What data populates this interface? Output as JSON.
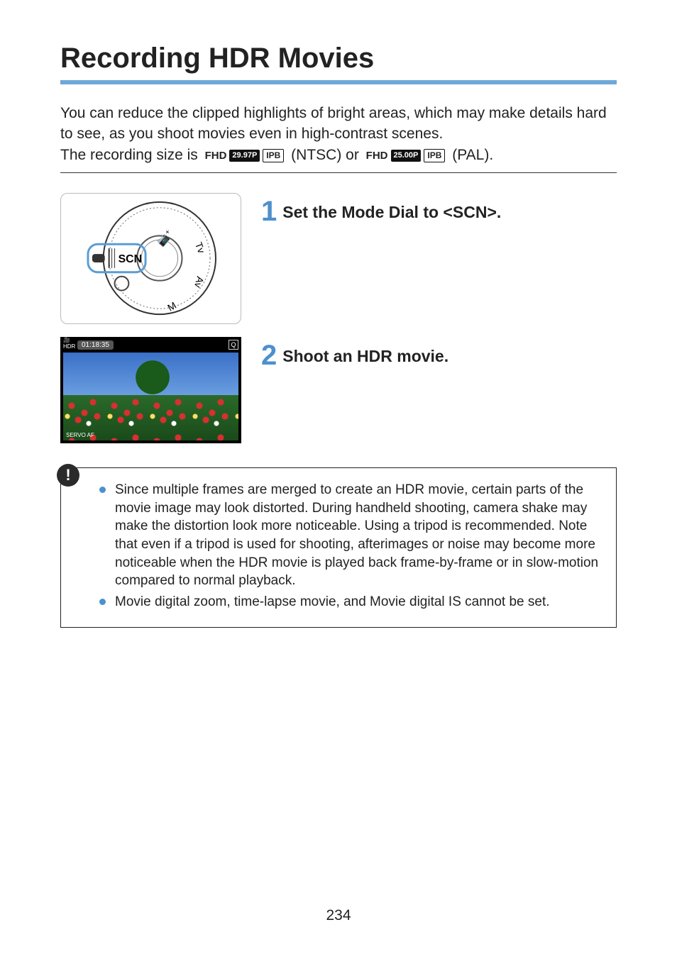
{
  "title": "Recording HDR Movies",
  "intro": {
    "line1": "You can reduce the clipped highlights of bright areas, which may make details hard to see, as you shoot movies even in high-contrast scenes.",
    "rec_label": "The recording size is",
    "ntsc": "(NTSC) or",
    "pal": "(PAL).",
    "fhd": "FHD",
    "fps_ntsc": "29.97P",
    "fps_pal": "25.00P",
    "ipb": "IPB"
  },
  "steps": [
    {
      "number": "1",
      "title_prefix": "Set the Mode Dial to <",
      "scn": "SCN",
      "title_suffix": ">."
    },
    {
      "number": "2",
      "title": "Shoot an HDR movie."
    }
  ],
  "screenshot": {
    "hdr": "HDR",
    "time": "01:18:35",
    "servo": "SERVO AF",
    "q": "Q"
  },
  "caution": {
    "items": [
      "Since multiple frames are merged to create an HDR movie, certain parts of the movie image may look distorted. During handheld shooting, camera shake may make the distortion look more noticeable. Using a tripod is recommended. Note that even if a tripod is used for shooting, afterimages or noise may become more noticeable when the HDR movie is played back frame-by-frame or in slow-motion compared to normal playback.",
      "Movie digital zoom, time-lapse movie, and Movie digital IS cannot be set."
    ]
  },
  "page_number": "234"
}
